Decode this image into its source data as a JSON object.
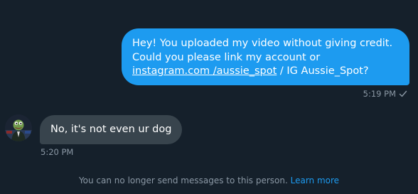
{
  "messages": {
    "outgoing": {
      "text_before": "Hey! You uploaded my video without giving credit. Could you please link my account or ",
      "link_text": "instagram.com /aussie_spot",
      "text_after": " / IG Aussie_Spot?",
      "time": "5:19 PM",
      "status_icon": "checkmark-icon"
    },
    "incoming": {
      "text": "No, it's not even ur dog",
      "time": "5:20 PM",
      "avatar_icon": "user-avatar"
    }
  },
  "notice": {
    "text": "You can no longer send messages to this person.",
    "link": "Learn more"
  },
  "colors": {
    "background": "#15202b",
    "outgoing_bubble": "#1d9bf0",
    "incoming_bubble": "#38444d",
    "muted_text": "#8b98a5",
    "link": "#1d9bf0"
  }
}
